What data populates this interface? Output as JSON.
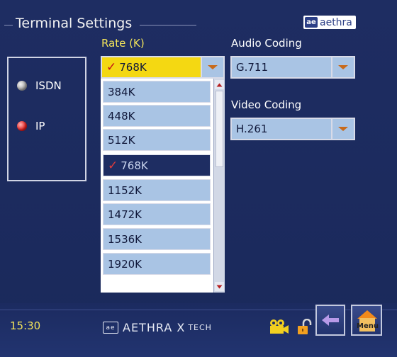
{
  "header": {
    "title": "Terminal Settings",
    "logo_text": "aethra",
    "logo_mark": "ae"
  },
  "network": {
    "options": [
      {
        "label": "ISDN",
        "selected": false
      },
      {
        "label": "IP",
        "selected": true
      }
    ]
  },
  "rate": {
    "label": "Rate (K)",
    "value": "768K",
    "options": [
      "384K",
      "448K",
      "512K",
      "768K",
      "1152K",
      "1472K",
      "1536K",
      "1920K"
    ],
    "selected_option": "768K"
  },
  "audio": {
    "label": "Audio Coding",
    "value": "G.711"
  },
  "video": {
    "label": "Video Coding",
    "value": "H.261"
  },
  "footer": {
    "time": "15:30",
    "brand": "AETHRA X",
    "brand_suffix": "TECH",
    "brand_mark": "ae",
    "menu_label": "Menu"
  },
  "icons": [
    "radio-icon",
    "chevron-down-icon",
    "check-icon",
    "camera-icon",
    "unlock-icon",
    "back-arrow-icon",
    "home-icon"
  ],
  "colors": {
    "background": "#1e2d62",
    "highlight": "#f4d812",
    "field": "#a9c4e4",
    "label_accent": "#f2e35a",
    "radio_active": "#e52020"
  }
}
